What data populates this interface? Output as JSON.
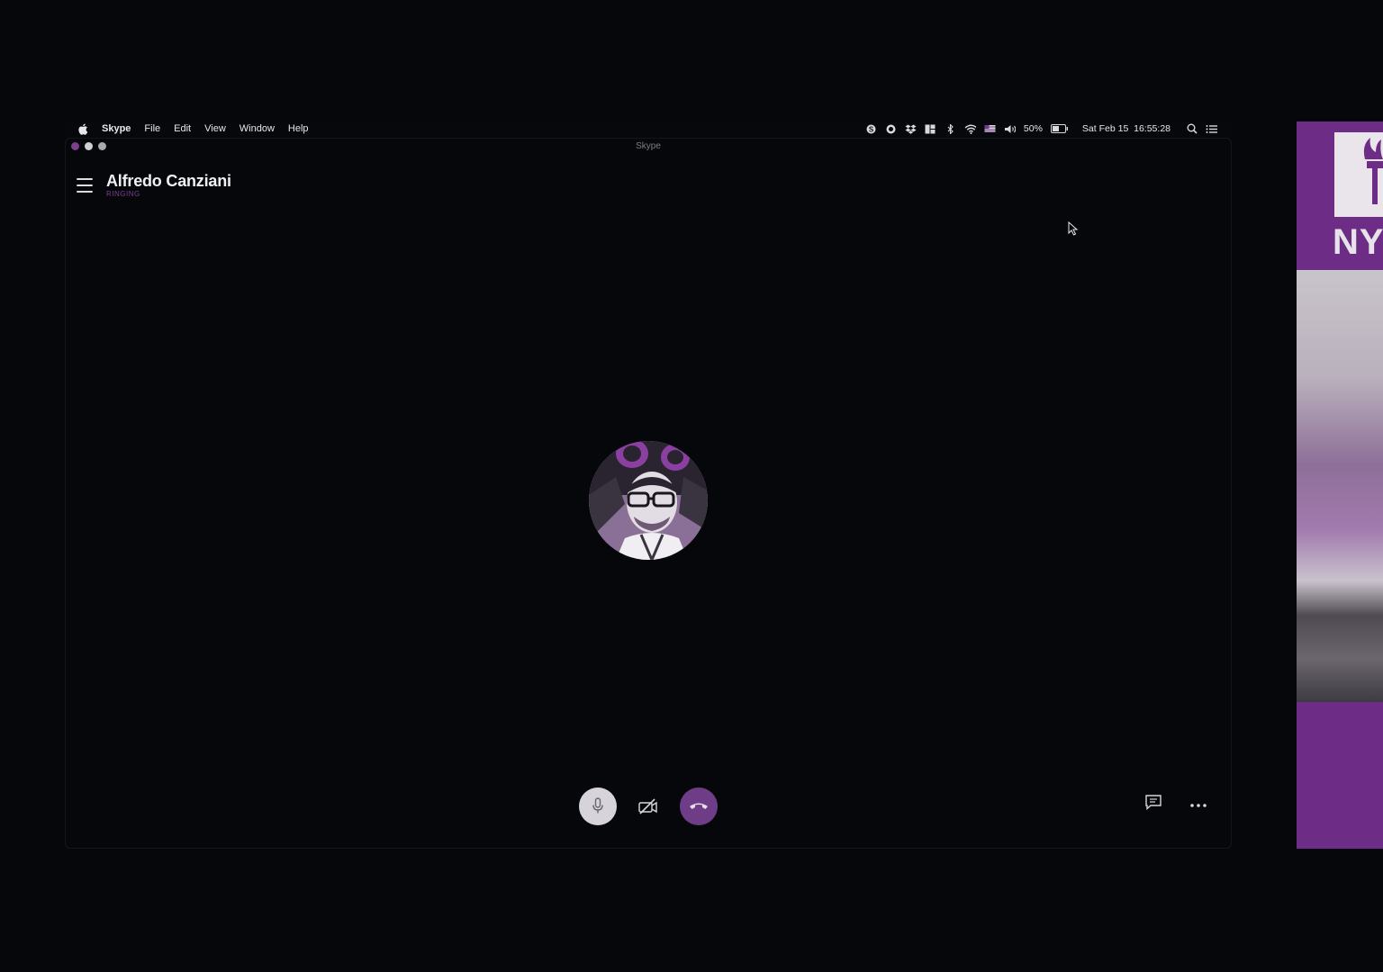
{
  "menubar": {
    "app_name": "Skype",
    "menus": [
      "File",
      "Edit",
      "View",
      "Window",
      "Help"
    ],
    "battery": "50%",
    "datetime": "Sat Feb 15  16:55:28",
    "tray_icons": [
      "skype-tray-icon",
      "record-icon",
      "dropbox-icon",
      "layout-icon",
      "bluetooth-icon",
      "wifi-icon",
      "flag-icon",
      "volume-icon",
      "battery-icon",
      "spotlight-icon",
      "notification-center-icon"
    ]
  },
  "window": {
    "title": "Skype"
  },
  "call": {
    "contact_name": "Alfredo Canziani",
    "status": "RINGING"
  },
  "side_panel": {
    "text": "NY"
  },
  "colors": {
    "background": "#06070b",
    "accent": "#6f3c88",
    "side_panel": "#6d2d86"
  }
}
